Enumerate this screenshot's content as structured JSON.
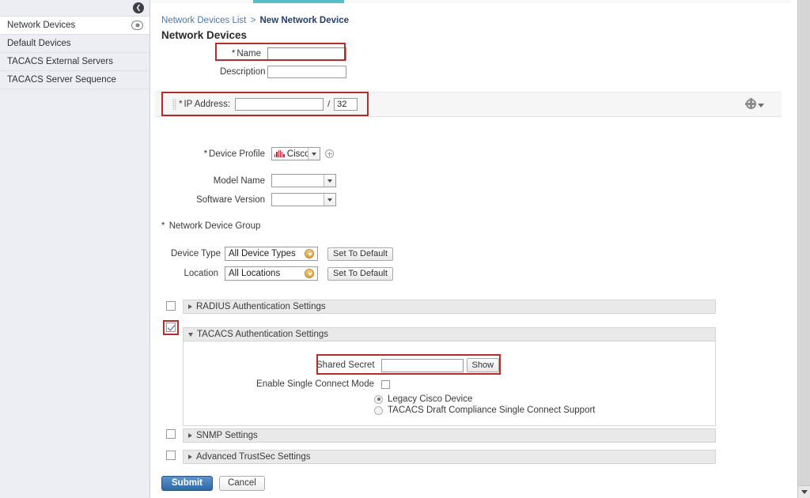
{
  "sidebar": {
    "collapse_icon": "collapse-left-icon",
    "items": [
      {
        "label": "Network Devices",
        "selected": true,
        "icon": "eye-icon"
      },
      {
        "label": "Default Devices",
        "selected": false
      },
      {
        "label": "TACACS External Servers",
        "selected": false
      },
      {
        "label": "TACACS Server Sequence",
        "selected": false
      }
    ]
  },
  "loading": {
    "accent_color": "#58bfc8"
  },
  "breadcrumb": {
    "parent": "Network Devices List",
    "separator": ">",
    "current": "New Network Device"
  },
  "page": {
    "title": "Network Devices"
  },
  "form": {
    "name": {
      "label": "Name",
      "required": "*",
      "value": "",
      "placeholder": ""
    },
    "description": {
      "label": "Description",
      "value": "",
      "placeholder": ""
    },
    "ip_address": {
      "label": "IP Address:",
      "required": "*",
      "value": "",
      "placeholder": "",
      "slash": "/",
      "mask": "32",
      "gear_icon": "gear-settings-icon"
    },
    "device_profile": {
      "label": "Device Profile",
      "required": "*",
      "value": "Cisco",
      "logo": "cisco-logo-icon",
      "add_icon": "add-circle-icon"
    },
    "model_name": {
      "label": "Model Name",
      "value": ""
    },
    "software_version": {
      "label": "Software Version",
      "value": ""
    },
    "network_device_group": {
      "title": "Network Device Group",
      "required": "*",
      "rows": [
        {
          "label": "Device Type",
          "value": "All Device Types",
          "button": "Set To Default"
        },
        {
          "label": "Location",
          "value": "All Locations",
          "button": "Set To Default"
        }
      ]
    }
  },
  "sections": {
    "radius": {
      "label": "RADIUS Authentication Settings",
      "checked": false,
      "expanded": false
    },
    "tacacs": {
      "label": "TACACS Authentication Settings",
      "checked": true,
      "expanded": true,
      "shared_secret": {
        "label": "Shared Secret",
        "value": "",
        "placeholder": "",
        "show_button": "Show"
      },
      "single_connect": {
        "label": "Enable Single Connect Mode",
        "checked": false
      },
      "radios": [
        {
          "label": "Legacy Cisco Device",
          "selected": true
        },
        {
          "label": "TACACS Draft Compliance Single Connect Support",
          "selected": false
        }
      ]
    },
    "snmp": {
      "label": "SNMP Settings",
      "checked": false,
      "expanded": false
    },
    "trustsec": {
      "label": "Advanced TrustSec Settings",
      "checked": false,
      "expanded": false
    }
  },
  "footer": {
    "submit": "Submit",
    "cancel": "Cancel"
  },
  "colors": {
    "highlight_red": "#b92b2b",
    "accent_teal": "#58bfc8",
    "link_blue": "#4a77b5",
    "submit_blue": "#2e68a5"
  }
}
